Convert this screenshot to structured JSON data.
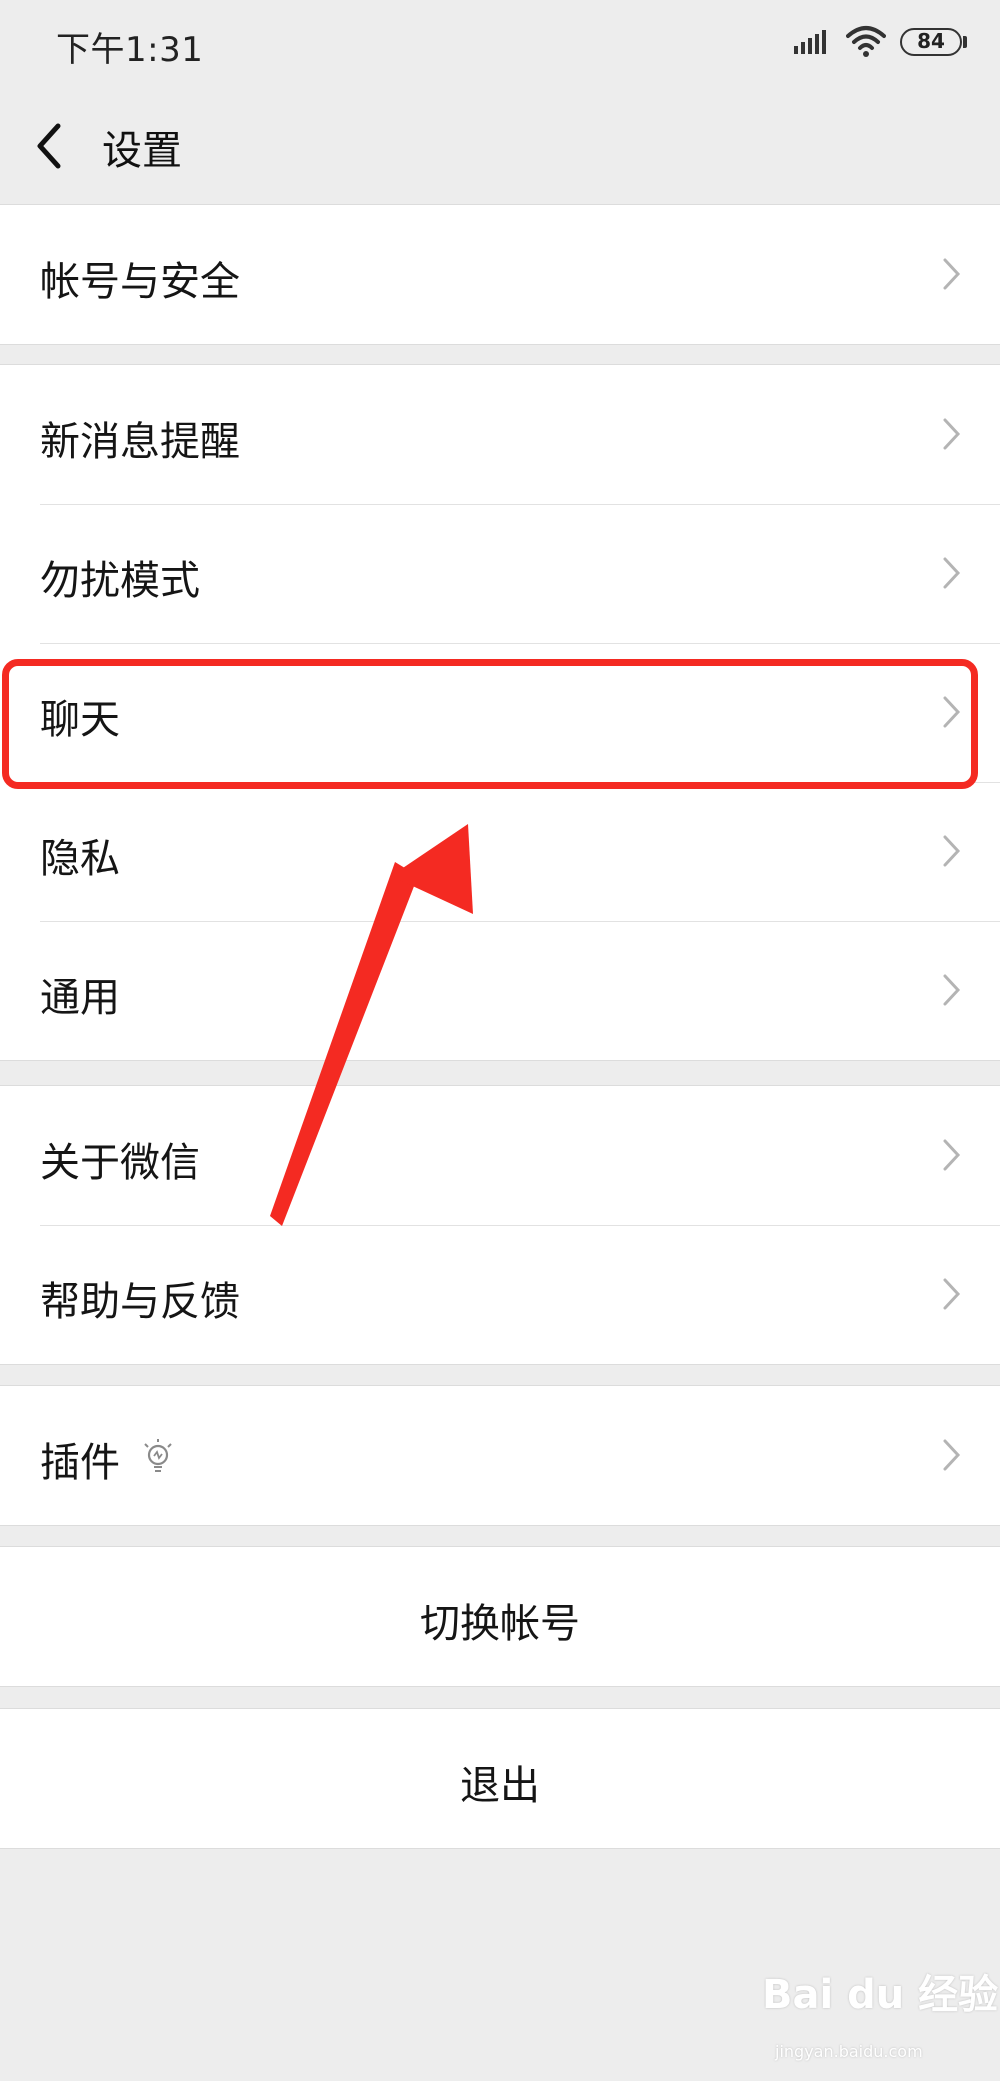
{
  "status_bar": {
    "time": "下午1:31",
    "battery": "84",
    "signal_icon": "signal-icon",
    "wifi_icon": "wifi-icon"
  },
  "nav": {
    "title": "设置",
    "back_icon": "back-chevron-icon"
  },
  "groups": [
    {
      "items": [
        "帐号与安全"
      ]
    },
    {
      "items": [
        "新消息提醒",
        "勿扰模式",
        "聊天",
        "隐私",
        "通用"
      ]
    },
    {
      "items": [
        "关于微信",
        "帮助与反馈"
      ]
    },
    {
      "items": [
        "插件"
      ]
    }
  ],
  "switch_account": "切换帐号",
  "logout": "退出",
  "annotation": {
    "highlight_color": "#f42a22",
    "highlighted_item": "聊天"
  },
  "watermark": {
    "text": "Bai du 经验",
    "sub": "jingyan.baidu.com"
  }
}
